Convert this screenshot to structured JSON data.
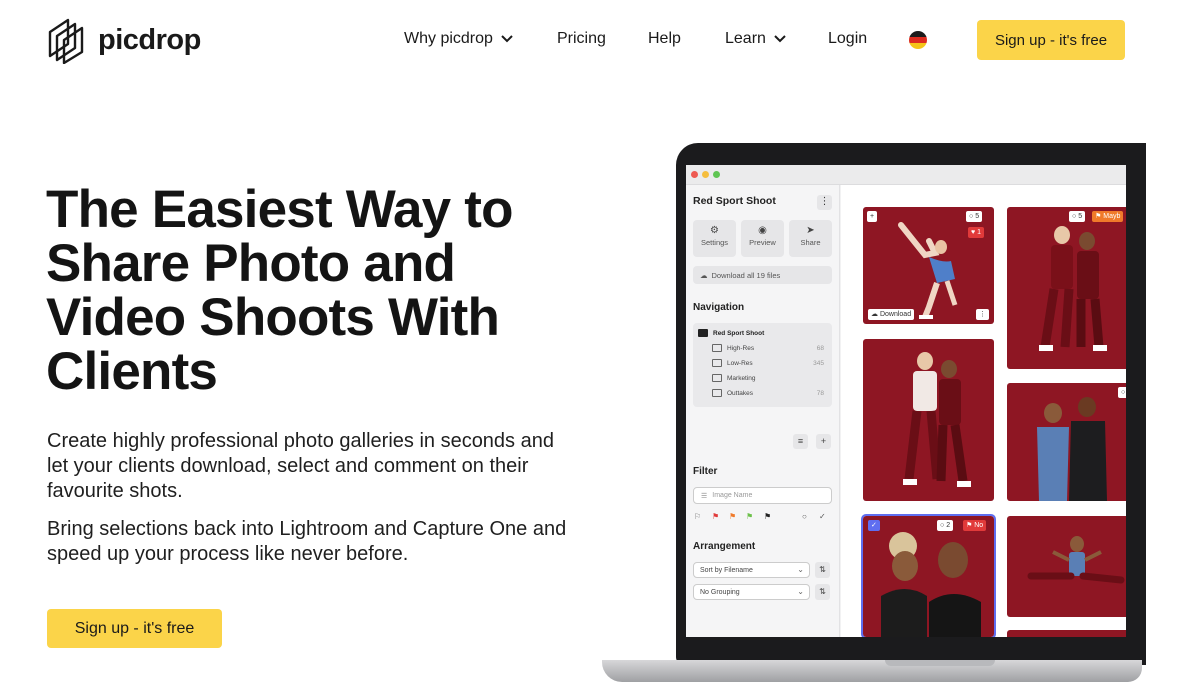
{
  "brand": {
    "name": "picdrop",
    "accent": "#fbd449"
  },
  "nav": {
    "items": [
      {
        "label": "Why picdrop",
        "has_menu": true
      },
      {
        "label": "Pricing",
        "has_menu": false
      },
      {
        "label": "Help",
        "has_menu": false
      },
      {
        "label": "Learn",
        "has_menu": true
      },
      {
        "label": "Login",
        "has_menu": false
      }
    ],
    "language_flag": "flag-germany-icon",
    "cta_label": "Sign up - it's free"
  },
  "hero": {
    "title_before": "The",
    "title_highlight": "Easiest",
    "title_after": " Way to Share Photo and Video Shoots With Clients",
    "paragraph1": "Create highly professional photo galleries in seconds and let your clients download, select and comment on their favourite shots.",
    "paragraph2": "Bring selections back into Lightroom and Capture One and speed up your process like never before.",
    "cta_label": "Sign up - it's free"
  },
  "app": {
    "gallery_title": "Red Sport Shoot",
    "tools": [
      {
        "label": "Settings",
        "icon": "gear-icon"
      },
      {
        "label": "Preview",
        "icon": "eye-icon"
      },
      {
        "label": "Share",
        "icon": "send-icon"
      }
    ],
    "download_all": "Download all 19 files",
    "navigation_heading": "Navigation",
    "folders": [
      {
        "name": "Red Sport Shoot",
        "count": ""
      },
      {
        "name": "High-Res",
        "count": "68"
      },
      {
        "name": "Low-Res",
        "count": "345"
      },
      {
        "name": "Marketing",
        "count": ""
      },
      {
        "name": "Outtakes",
        "count": "78"
      }
    ],
    "filter_heading": "Filter",
    "filter_placeholder": "Image Name",
    "arrangement_heading": "Arrangement",
    "sort_value": "Sort by Filename",
    "grouping_value": "No Grouping",
    "photos": [
      {
        "comments": "5",
        "likes": "1",
        "action": "Download"
      },
      {
        "comments": "5",
        "flag": "Mayb"
      },
      {
        "comments": "2",
        "flag": "No",
        "selected": true
      }
    ],
    "photo_bg": "#8e1623"
  }
}
